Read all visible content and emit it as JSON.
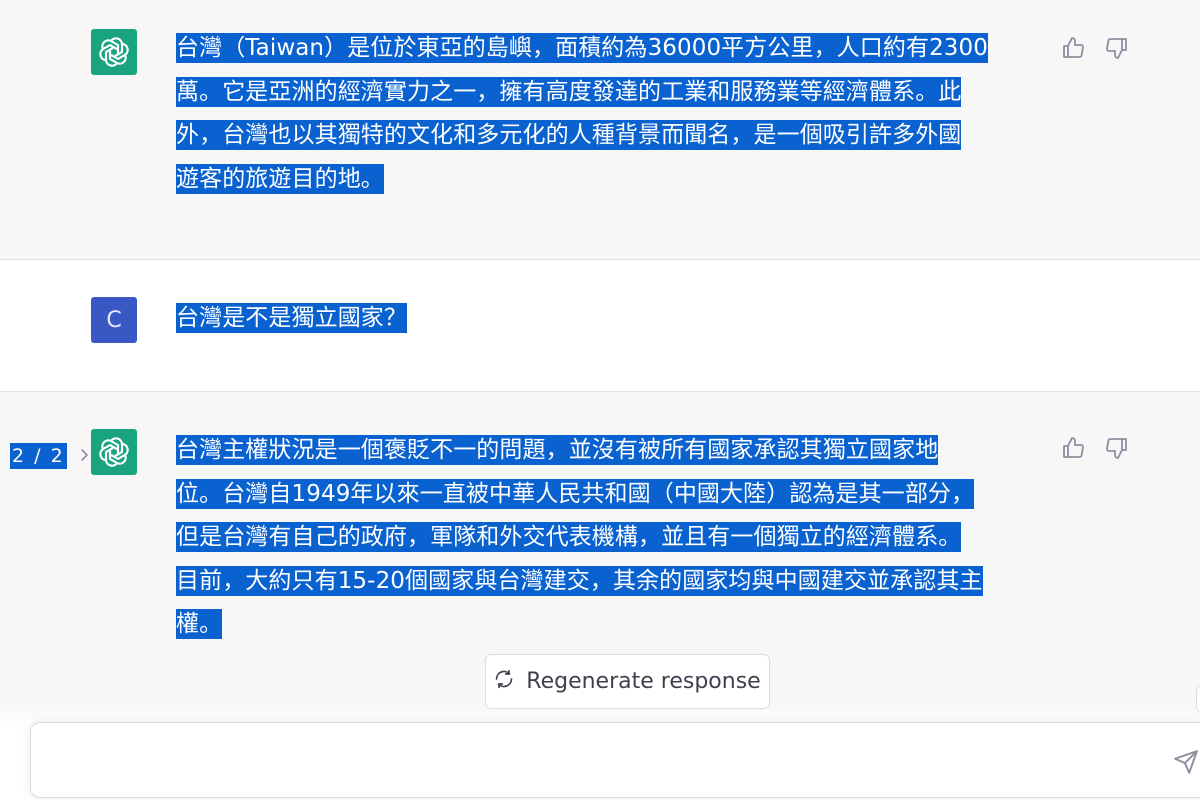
{
  "messages": [
    {
      "role": "assistant",
      "avatar_icon": "openai-logo-icon",
      "lines": [
        "台灣（Taiwan）是位於東亞的島嶼，面積約為36000平方公里，人口約有2300",
        "萬。它是亞洲的經濟實力之一，擁有高度發達的工業和服務業等經濟體系。此",
        "外，台灣也以其獨特的文化和多元化的人種背景而聞名，是一個吸引許多外國",
        "遊客的旅遊目的地。"
      ]
    },
    {
      "role": "user",
      "avatar_letter": "C",
      "lines": [
        "台灣是不是獨立國家？"
      ]
    },
    {
      "role": "assistant",
      "avatar_icon": "openai-logo-icon",
      "pager": "2 / 2",
      "lines": [
        "台灣主權狀況是一個褒貶不一的問題，並沒有被所有國家承認其獨立國家地",
        "位。台灣自1949年以來一直被中華人民共和國（中國大陸）認為是其一部分，",
        "但是台灣有自己的政府，軍隊和外交代表機構，並且有一個獨立的經濟體系。",
        "目前，大約只有15-20個國家與台灣建交，其余的國家均與中國建交並承認其主",
        "權。"
      ]
    }
  ],
  "regenerate_label": "Regenerate response",
  "composer": {
    "placeholder": ""
  },
  "colors": {
    "selection": "#0a62d0",
    "gpt_avatar": "#19a37f",
    "user_avatar": "#3a58c4",
    "assistant_bg": "#f7f7f8",
    "user_bg": "#ffffff"
  },
  "icons": {
    "thumbs_up": "thumbs-up-icon",
    "thumbs_down": "thumbs-down-icon",
    "regenerate": "refresh-icon",
    "send": "send-icon",
    "pager_next": "chevron-right-icon"
  }
}
